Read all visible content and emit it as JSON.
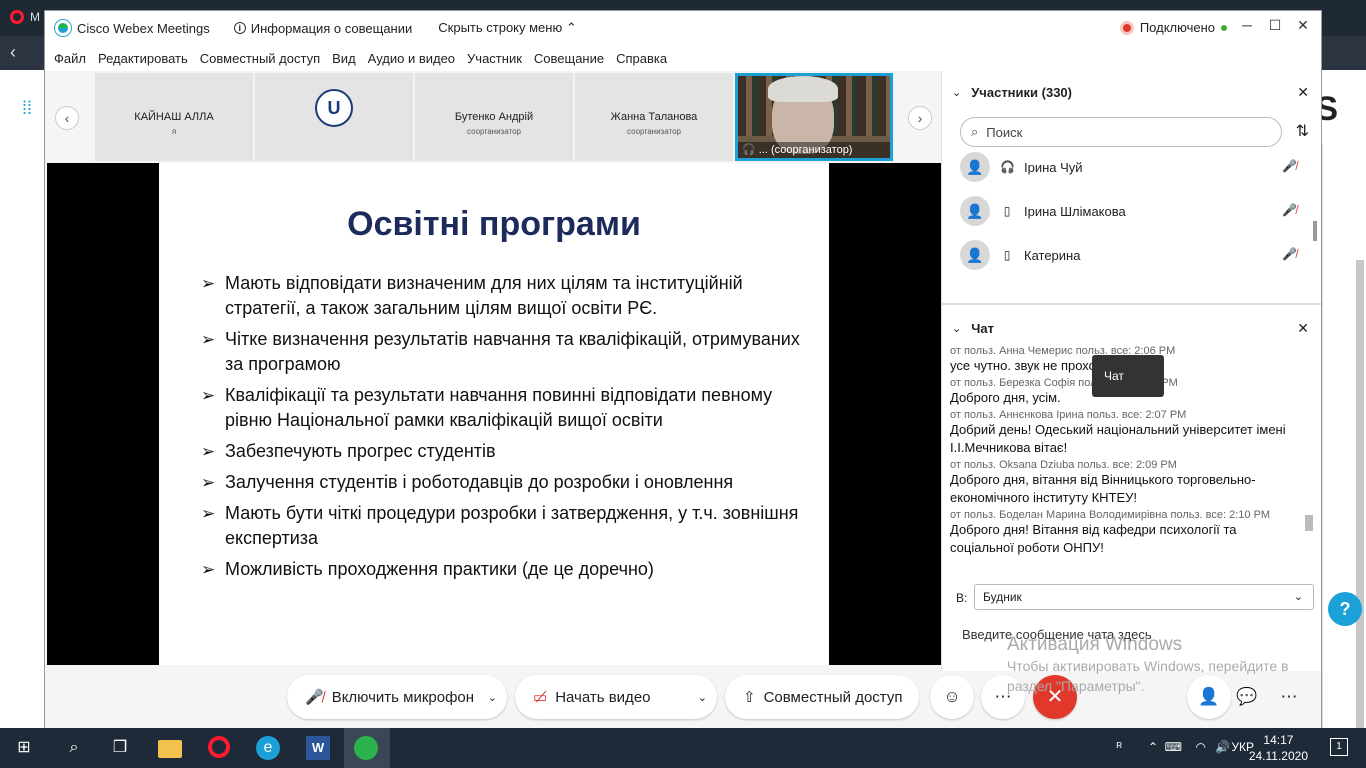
{
  "browser": {
    "tab_label": "M"
  },
  "window": {
    "app_title": "Cisco Webex Meetings",
    "info_label": "Информация о совещании",
    "hide_menu_label": "Скрыть строку меню",
    "status_label": "Подключено"
  },
  "menu": [
    "Файл",
    "Редактировать",
    "Совместный доступ",
    "Вид",
    "Аудио и видео",
    "Участник",
    "Совещание",
    "Справка"
  ],
  "thumbnails": [
    {
      "name": "КАЙНАШ АЛЛА",
      "role": "я"
    },
    {
      "name": "",
      "role": ""
    },
    {
      "name": "Бутенко Андрій",
      "role": "соорганизатор"
    },
    {
      "name": "Жанна Таланова",
      "role": "соорганизатор"
    }
  ],
  "video_caption": "... (соорганизатор)",
  "slide": {
    "title": "Освітні програми",
    "bullets": [
      "Мають відповідати визначеним для них цілям та інституційній стратегії, а також загальним цілям вищої освіти РЄ.",
      "Чітке визначення результатів навчання та кваліфікацій, отримуваних за програмою",
      "Кваліфікації та результати навчання повинні відповідати певному рівню Національної рамки кваліфікацій вищої освіти",
      "Забезпечують прогрес студентів",
      "Залучення студентів і роботодавців до розробки і оновлення",
      "Мають бути чіткі процедури розробки і затвердження, у т.ч. зовнішня експертиза",
      "Можливість проходження практики (де це доречно)"
    ]
  },
  "participants": {
    "header": "Участники (330)",
    "search_placeholder": "Поиск",
    "list": [
      {
        "name": "Ірина Чуй",
        "device": "headset"
      },
      {
        "name": "Ірина Шлімакова",
        "device": "phone"
      },
      {
        "name": "Катерина",
        "device": "phone"
      }
    ]
  },
  "chat": {
    "header": "Чат",
    "tooltip": "Чат",
    "messages": [
      {
        "meta": "от польз. Анна Чемерис польз. все:  2:06 PM",
        "text": "усе чутно. звук не проходит"
      },
      {
        "meta": "от польз. Березка Софія польз. все:  2:07 PM",
        "text": "Доброго дня, усім."
      },
      {
        "meta": "от польз. Аннєнкова Ірина польз. все:    2:07 PM",
        "text": "Добрий день! Одеський національний університет імені І.І.Мечникова вітає!"
      },
      {
        "meta": "от польз. Oksana Dziuba польз. все:    2:09 PM",
        "text": "Доброго дня, вітання від Вінницького торговельно-економічного інституту КНТЕУ!"
      },
      {
        "meta": "от польз. Боделан Марина Володимирівна польз. все:    2:10 PM",
        "text": "Доброго дня! Вітання від кафедри психології та соціальної роботи ОНПУ!"
      }
    ],
    "to_label": "В:",
    "to_value": "Будник",
    "input_placeholder": "Введите сообщение чата здесь"
  },
  "activation": {
    "title": "Активация Windows",
    "subtitle": "Чтобы активировать Windows, перейдите в раздел \"Параметры\"."
  },
  "controls": {
    "mic_label": "Включить микрофон",
    "video_label": "Начать видео",
    "share_label": "Совместный доступ"
  },
  "taskbar": {
    "lang": "УКР",
    "time": "14:17",
    "date": "24.11.2020",
    "notif_count": "1"
  }
}
